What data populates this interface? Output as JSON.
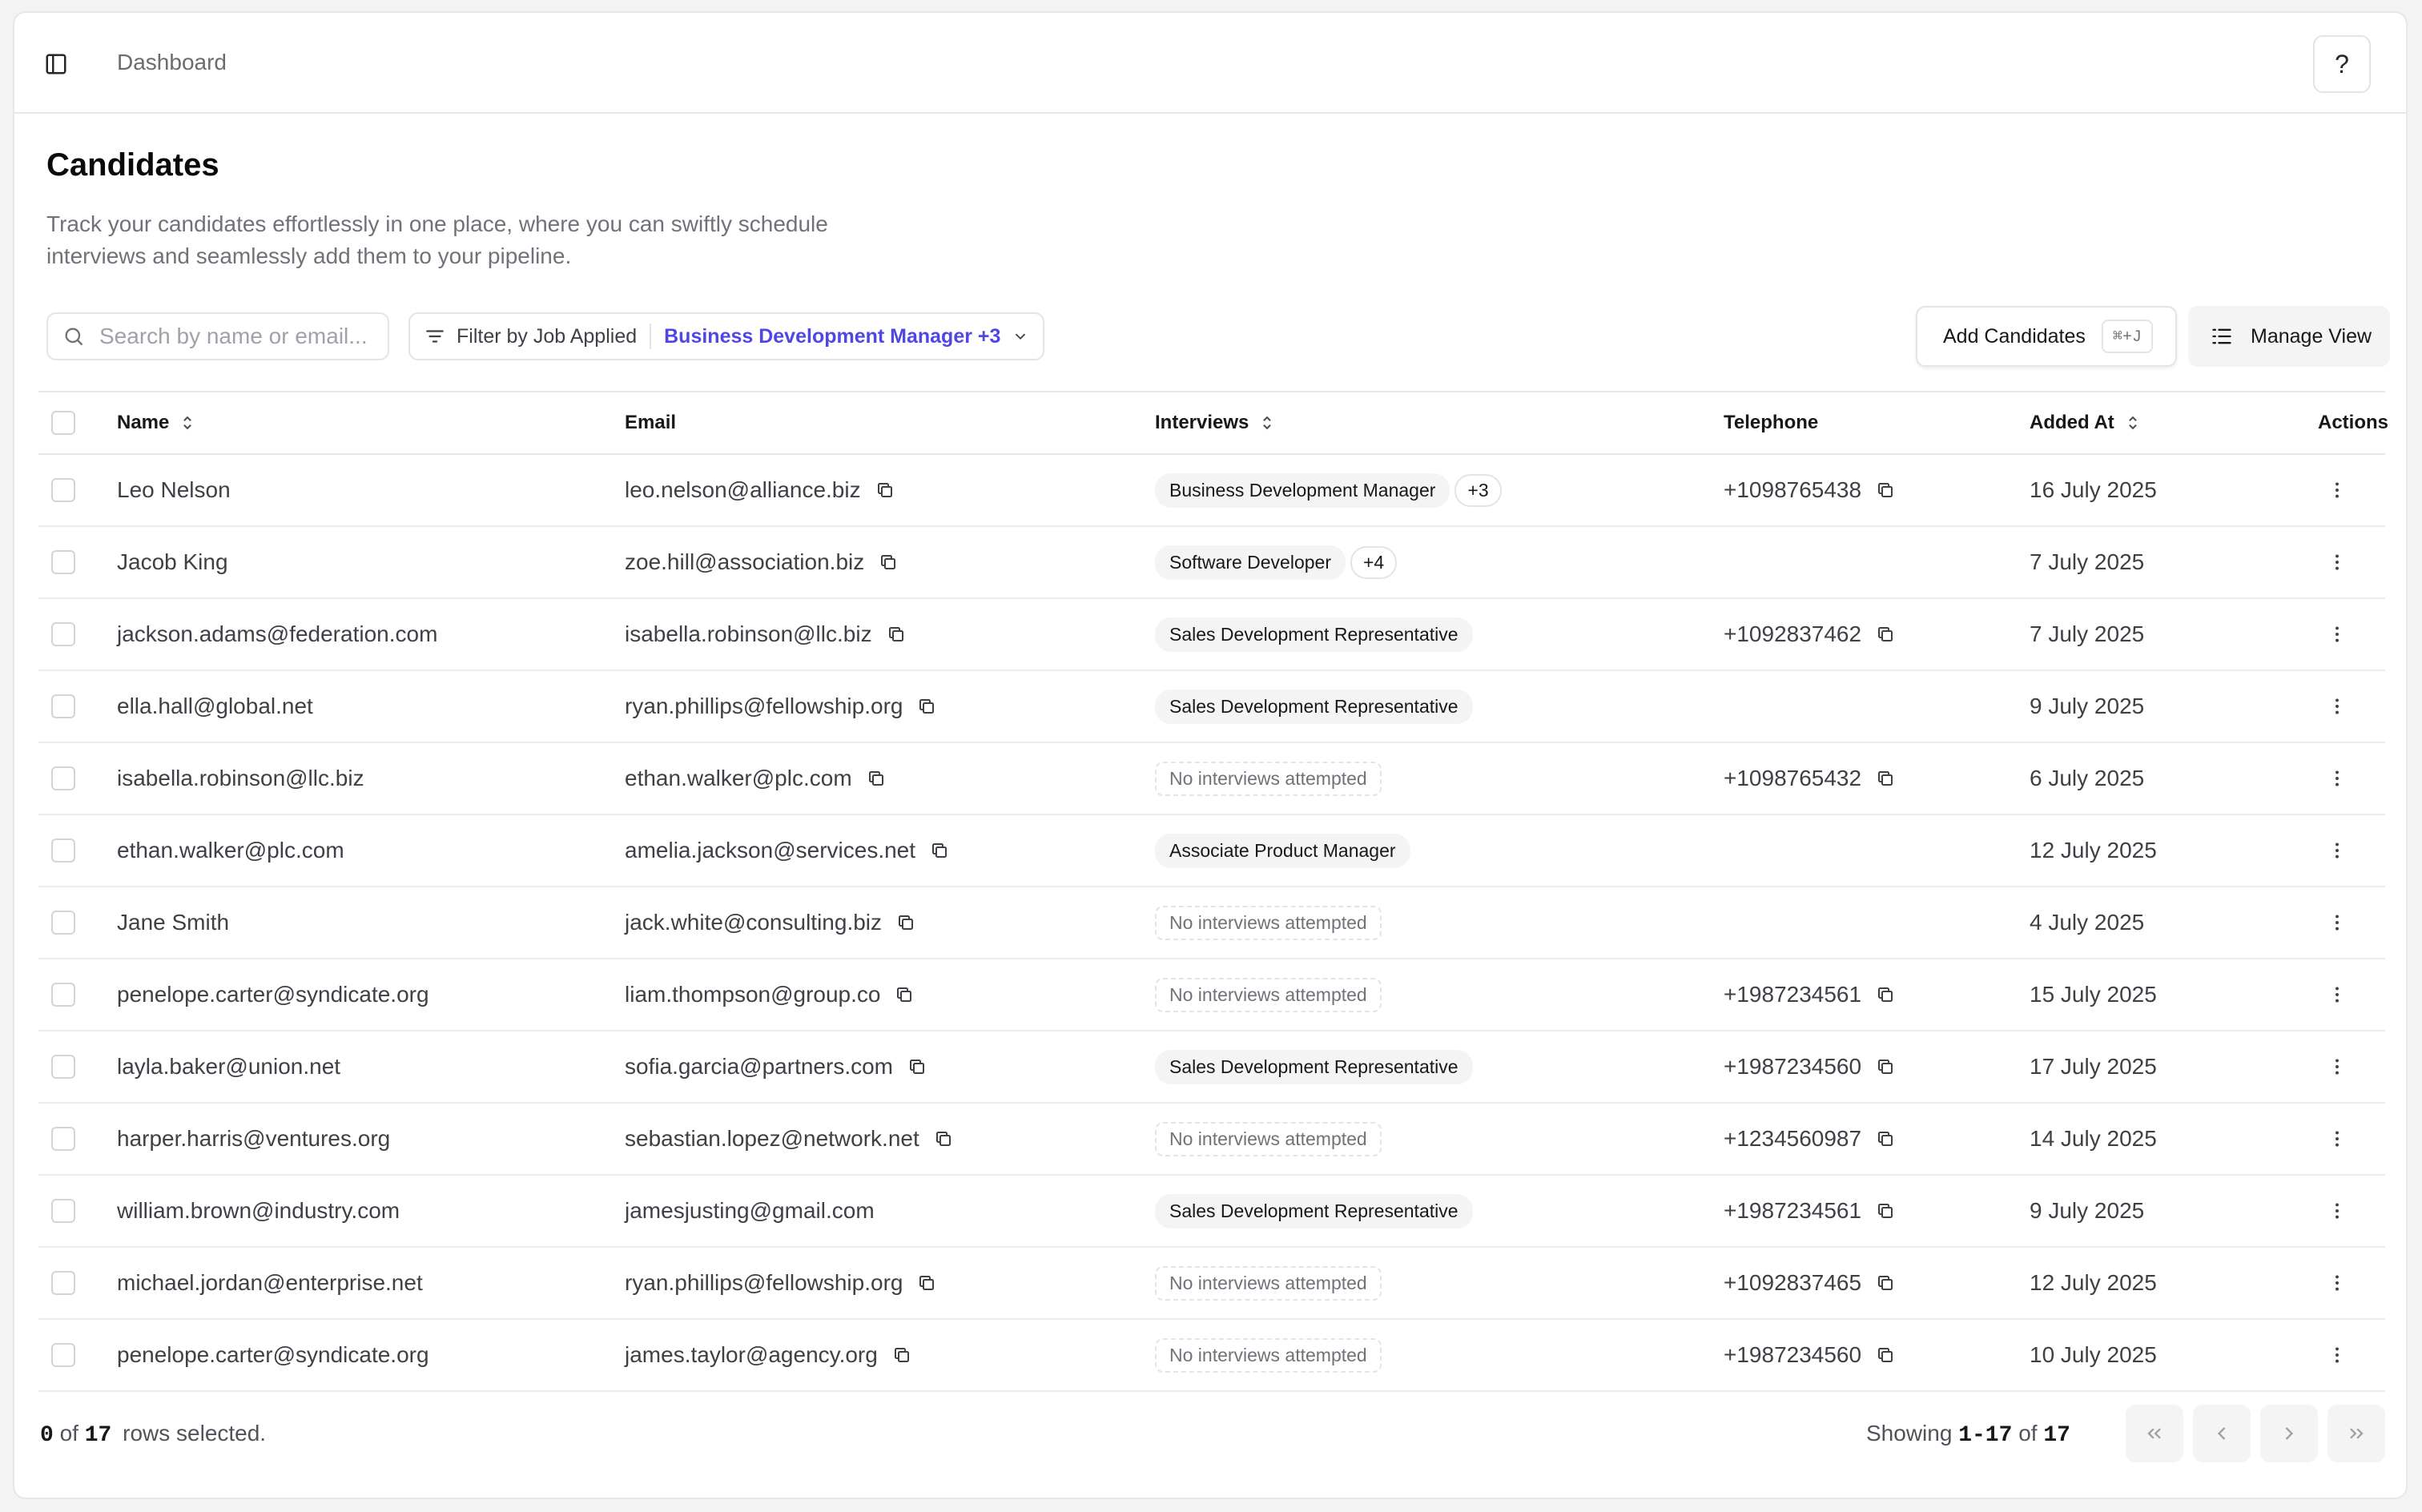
{
  "breadcrumb": {
    "current": "Dashboard"
  },
  "help": {
    "label": "?"
  },
  "page": {
    "title": "Candidates",
    "description": "Track your candidates effortlessly in one place, where you can swiftly schedule interviews and seamlessly add them to your pipeline."
  },
  "toolbar": {
    "search_placeholder": "Search by name or email...",
    "filter_label": "Filter by Job Applied",
    "filter_value": "Business Development Manager +3",
    "add_label": "Add Candidates",
    "add_shortcut": "⌘+J",
    "manage_label": "Manage View"
  },
  "table": {
    "columns": {
      "name": "Name",
      "email": "Email",
      "interviews": "Interviews",
      "telephone": "Telephone",
      "added_at": "Added At",
      "actions": "Actions"
    },
    "rows": [
      {
        "name": "Leo Nelson",
        "email": "leo.nelson@alliance.biz",
        "interview": "Business Development Manager",
        "extra": "+3",
        "telephone": "+1098765438",
        "added": "16 July 2025"
      },
      {
        "name": "Jacob King",
        "email": "zoe.hill@association.biz",
        "interview": "Software Developer",
        "extra": "+4",
        "telephone": "",
        "added": "7 July 2025"
      },
      {
        "name": "jackson.adams@federation.com",
        "email": "isabella.robinson@llc.biz",
        "interview": "Sales Development Representative",
        "extra": "",
        "telephone": "+1092837462",
        "added": "7 July 2025"
      },
      {
        "name": "ella.hall@global.net",
        "email": "ryan.phillips@fellowship.org",
        "interview": "Sales Development Representative",
        "extra": "",
        "telephone": "",
        "added": "9 July 2025"
      },
      {
        "name": "isabella.robinson@llc.biz",
        "email": "ethan.walker@plc.com",
        "interview": "",
        "extra": "",
        "telephone": "+1098765432",
        "added": "6 July 2025"
      },
      {
        "name": "ethan.walker@plc.com",
        "email": "amelia.jackson@services.net",
        "interview": "Associate Product Manager",
        "extra": "",
        "telephone": "",
        "added": "12 July 2025"
      },
      {
        "name": "Jane Smith",
        "email": "jack.white@consulting.biz",
        "interview": "",
        "extra": "",
        "telephone": "",
        "added": "4 July 2025"
      },
      {
        "name": "penelope.carter@syndicate.org",
        "email": "liam.thompson@group.co",
        "interview": "",
        "extra": "",
        "telephone": "+1987234561",
        "added": "15 July 2025"
      },
      {
        "name": "layla.baker@union.net",
        "email": "sofia.garcia@partners.com",
        "interview": "Sales Development Representative",
        "extra": "",
        "telephone": "+1987234560",
        "added": "17 July 2025"
      },
      {
        "name": "harper.harris@ventures.org",
        "email": "sebastian.lopez@network.net",
        "interview": "",
        "extra": "",
        "telephone": "+1234560987",
        "added": "14 July 2025"
      },
      {
        "name": "william.brown@industry.com",
        "email": "jamesjusting@gmail.com",
        "interview": "Sales Development Representative",
        "extra": "",
        "telephone": "+1987234561",
        "added": "9 July 2025"
      },
      {
        "name": "michael.jordan@enterprise.net",
        "email": "ryan.phillips@fellowship.org",
        "interview": "",
        "extra": "",
        "telephone": "+1092837465",
        "added": "12 July 2025"
      },
      {
        "name": "penelope.carter@syndicate.org",
        "email": "james.taylor@agency.org",
        "interview": "",
        "extra": "",
        "telephone": "+1987234560",
        "added": "10 July 2025"
      }
    ],
    "no_interviews_text": "No interviews attempted"
  },
  "footer": {
    "selected_count": "0",
    "of_text": "of",
    "total_rows": "17",
    "rows_selected_text": "rows selected.",
    "showing_text": "Showing",
    "range": "1-17",
    "total": "17"
  },
  "colors": {
    "accent": "#4f46e5",
    "border": "#e4e4e7",
    "muted": "#71717a"
  }
}
